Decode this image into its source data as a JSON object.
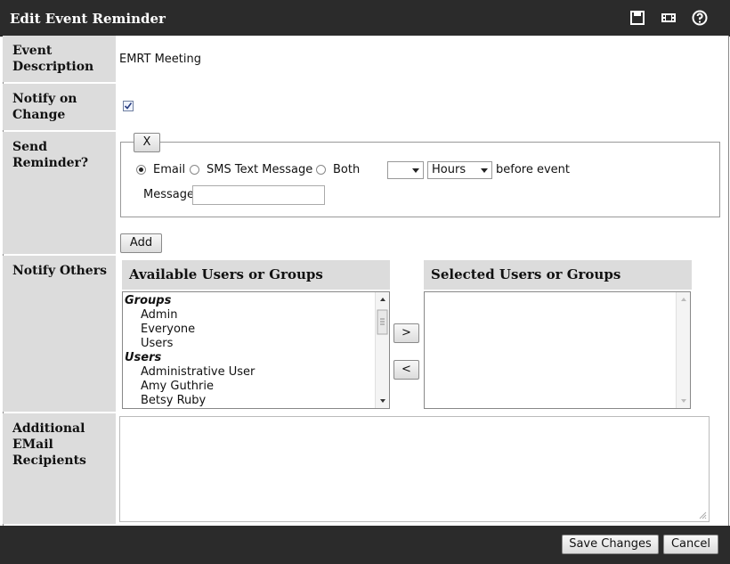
{
  "window": {
    "title": "Edit Event Reminder",
    "toolbar_icons": [
      "save-icon",
      "film-icon",
      "help-icon"
    ]
  },
  "rows": {
    "event_description": {
      "label_lines": [
        "Event",
        "Description"
      ],
      "value": "EMRT Meeting"
    },
    "notify_on_change": {
      "label_lines": [
        "Notify on",
        "Change"
      ],
      "checked": true
    },
    "send_reminder": {
      "label_lines": [
        "Send",
        "Reminder?"
      ],
      "remove_label": "X",
      "options": [
        {
          "label": "Email",
          "selected": true
        },
        {
          "label": "SMS Text Message",
          "selected": false
        },
        {
          "label": "Both",
          "selected": false
        }
      ],
      "amount_value": "",
      "unit_value": "Hours",
      "suffix": "before event",
      "message_label": "Message",
      "message_value": "",
      "add_label": "Add"
    },
    "notify_others": {
      "label": "Notify Others",
      "available_header": "Available Users or Groups",
      "selected_header": "Selected Users or Groups",
      "available_items": [
        {
          "text": "Groups",
          "type": "group"
        },
        {
          "text": "Admin",
          "type": "item"
        },
        {
          "text": "Everyone",
          "type": "item"
        },
        {
          "text": "Users",
          "type": "item"
        },
        {
          "text": "Users",
          "type": "group"
        },
        {
          "text": "Administrative User",
          "type": "item"
        },
        {
          "text": "Amy Guthrie",
          "type": "item"
        },
        {
          "text": "Betsy Ruby",
          "type": "item"
        }
      ],
      "add_arrow": ">",
      "remove_arrow": "<"
    },
    "additional_recipients": {
      "label_lines": [
        "Additional",
        "EMail",
        "Recipients"
      ],
      "value": ""
    }
  },
  "footer": {
    "save_label": "Save Changes",
    "cancel_label": "Cancel"
  }
}
